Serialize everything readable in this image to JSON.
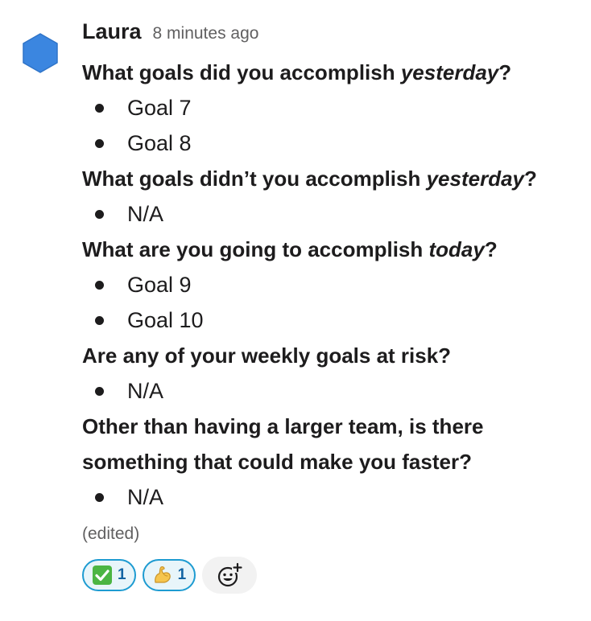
{
  "message": {
    "author": "Laura",
    "timestamp": "8 minutes ago",
    "avatar_icon": "hexagon-avatar",
    "avatar_color": "#3b86e0",
    "edited_label": "(edited)",
    "sections": [
      {
        "question_prefix": "What goals did you accomplish ",
        "question_emphasis": "yesterday",
        "question_suffix": "?",
        "answers": [
          "Goal 7",
          "Goal 8"
        ]
      },
      {
        "question_prefix": "What goals didn’t you accomplish ",
        "question_emphasis": "yesterday",
        "question_suffix": "?",
        "answers": [
          "N/A"
        ]
      },
      {
        "question_prefix": "What are you going to accomplish ",
        "question_emphasis": "today",
        "question_suffix": "?",
        "answers": [
          "Goal 9",
          "Goal 10"
        ]
      },
      {
        "question_prefix": "Are any of your weekly goals at risk?",
        "question_emphasis": "",
        "question_suffix": "",
        "answers": [
          "N/A"
        ]
      },
      {
        "question_prefix": "Other than having a larger team, is there something that could make you faster?",
        "question_emphasis": "",
        "question_suffix": "",
        "answers": [
          "N/A"
        ]
      }
    ],
    "reactions": [
      {
        "icon": "white-check-mark-icon",
        "count": "1"
      },
      {
        "icon": "flexed-biceps-icon",
        "count": "1"
      }
    ],
    "add_reaction_icon": "add-reaction-icon"
  },
  "colors": {
    "reaction_border": "#1d9bd1",
    "reaction_bg": "#e8f5fa",
    "reaction_count": "#1264a3",
    "muted_text": "#616061"
  }
}
